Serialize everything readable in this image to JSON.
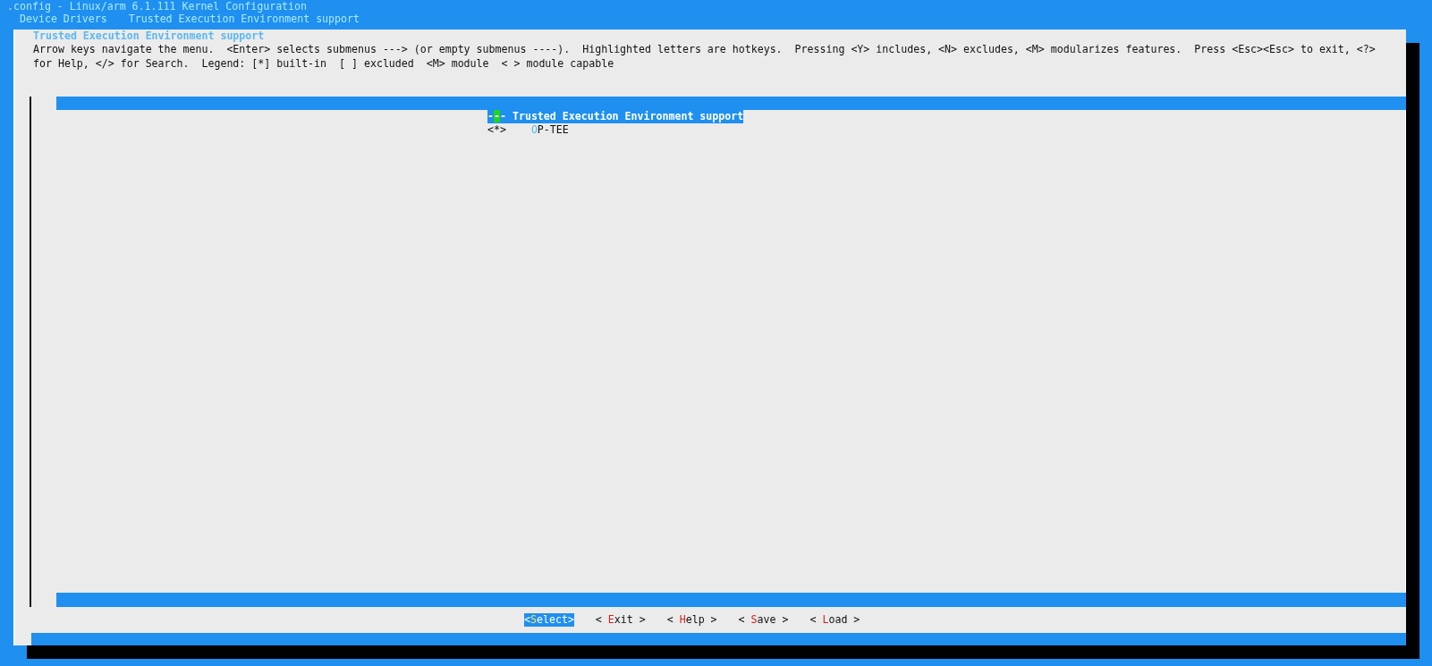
{
  "header": {
    "title": ".config - Linux/arm 6.1.111 Kernel Configuration",
    "breadcrumb": [
      "Device Drivers",
      "Trusted Execution Environment support"
    ]
  },
  "dialog": {
    "title": "Trusted Execution Environment support",
    "help_lines": [
      "Arrow keys navigate the menu.  <Enter> selects submenus ---> (or empty submenus ----).  Highlighted letters are hotkeys.  Pressing <Y> includes, <N> excludes, <M> modularizes features.  Press <Esc><Esc> to exit, <?>",
      "for Help, </> for Search.  Legend: [*] built-in  [ ] excluded  <M> module  < > module capable"
    ]
  },
  "menu": {
    "items": [
      {
        "open": "-",
        "mark": "-",
        "close": "-",
        "cursor": true,
        "label": "Trusted Execution Environment support",
        "selected": true
      },
      {
        "open": "<",
        "mark": "*",
        "close": ">",
        "cursor": false,
        "hotkey": "O",
        "label": "P-TEE",
        "selected": false
      }
    ]
  },
  "buttons": [
    {
      "pre": "<",
      "hotkey": "S",
      "rest": "elect",
      "post": ">",
      "selected": true
    },
    {
      "pre": "< ",
      "hotkey": "E",
      "rest": "xit",
      "post": " >",
      "selected": false
    },
    {
      "pre": "< ",
      "hotkey": "H",
      "rest": "elp",
      "post": " >",
      "selected": false
    },
    {
      "pre": "< ",
      "hotkey": "S",
      "rest": "ave",
      "post": " >",
      "selected": false
    },
    {
      "pre": "< ",
      "hotkey": "L",
      "rest": "oad",
      "post": " >",
      "selected": false
    }
  ]
}
